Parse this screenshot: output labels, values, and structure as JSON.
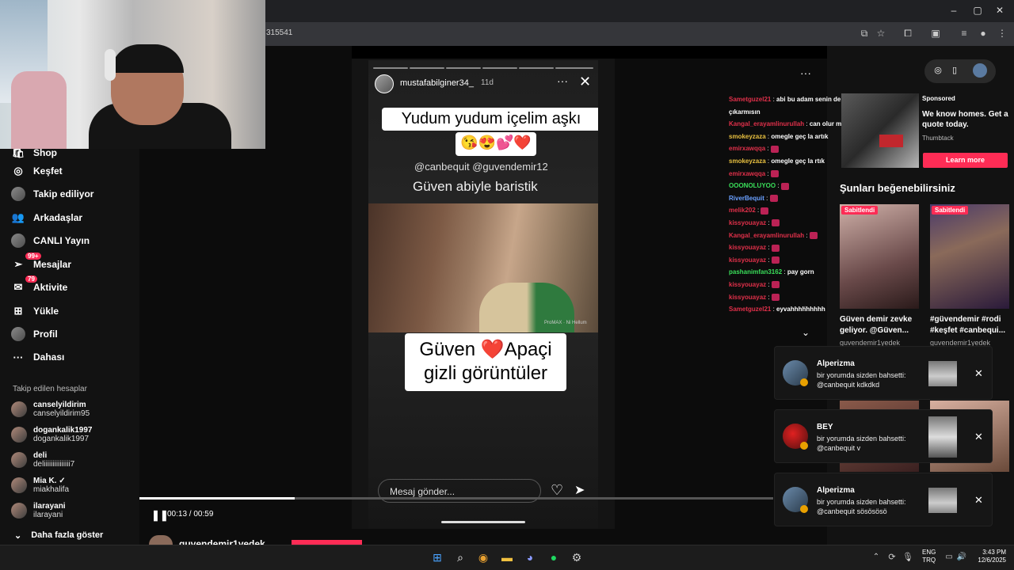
{
  "browser": {
    "url_fragment": "315541",
    "window_controls": [
      "minimize",
      "maximize",
      "close"
    ]
  },
  "sidebar": {
    "items": [
      {
        "label": "Shop",
        "icon": "shop-icon"
      },
      {
        "label": "Keşfet",
        "icon": "compass-icon"
      },
      {
        "label": "Takip ediliyor",
        "icon": "following-avatar-icon"
      },
      {
        "label": "Arkadaşlar",
        "icon": "friends-icon"
      },
      {
        "label": "CANLI Yayın",
        "icon": "live-icon"
      },
      {
        "label": "Mesajlar",
        "icon": "messages-icon",
        "badge": "99+"
      },
      {
        "label": "Aktivite",
        "icon": "activity-icon",
        "badge": "79"
      },
      {
        "label": "Yükle",
        "icon": "upload-icon"
      },
      {
        "label": "Profil",
        "icon": "profile-icon"
      },
      {
        "label": "Dahası",
        "icon": "more-icon"
      }
    ],
    "following_title": "Takip edilen hesaplar",
    "accounts": [
      {
        "name": "canselyildirim",
        "handle": "canselyildirim95"
      },
      {
        "name": "dogankalik1997",
        "handle": "dogankalik1997"
      },
      {
        "name": "deli",
        "handle": "deliiiiiiiiiiiiiii7"
      },
      {
        "name": "Mia K. ✓",
        "handle": "miakhalifa"
      },
      {
        "name": "ilarayani",
        "handle": "ilarayani"
      }
    ],
    "show_more": "Daha fazla göster"
  },
  "story": {
    "username": "mustafabilginer34_",
    "time": "11d",
    "caption1": "Yudum yudum içelim aşkı",
    "caption_emoji": "😘😍💕❤️",
    "mentions": "@canbequit @guvendemir12",
    "subline": "Güven abiyle baristik",
    "watermark": "ProMAX  · Ni Hellum",
    "caption2_line1": "Güven ❤️Apaçi",
    "caption2_line2": "gizli görüntüler",
    "message_placeholder": "Mesaj gönder...",
    "progress_segments": 6
  },
  "video": {
    "time": "00:13 / 00:59",
    "progress": 0.245
  },
  "chat": [
    {
      "user": "Sametguzel21",
      "color": "#e0304a",
      "msg": "abi bu adam senin de ifşanı"
    },
    {
      "user": "",
      "color": "#ffffff",
      "msg": "çıkarmısın"
    },
    {
      "user": "Kangal_erayamlinurullah",
      "color": "#e0304a",
      "msg": "can olur musun"
    },
    {
      "user": "smokeyzaza",
      "color": "#e8c040",
      "msg": "omegle geç la artık"
    },
    {
      "user": "emirxawqqa",
      "color": "#e0304a",
      "msg": "",
      "emote": true
    },
    {
      "user": "smokeyzaza",
      "color": "#e8c040",
      "msg": "omegle geç la rtık"
    },
    {
      "user": "emirxawqqa",
      "color": "#e0304a",
      "msg": "",
      "emote": true
    },
    {
      "user": "OOONOLUYOO",
      "color": "#3adf5a",
      "msg": "",
      "emote": true
    },
    {
      "user": "RiverBequit",
      "color": "#6aa0ff",
      "msg": "",
      "emote": true
    },
    {
      "user": "melik202",
      "color": "#e0304a",
      "msg": "",
      "emote": true
    },
    {
      "user": "kissyouayaz",
      "color": "#e0304a",
      "msg": "",
      "emote": true
    },
    {
      "user": "Kangal_erayamlinurullah",
      "color": "#e0304a",
      "msg": "",
      "emote": true
    },
    {
      "user": "kissyouayaz",
      "color": "#e0304a",
      "msg": "",
      "emote": true
    },
    {
      "user": "kissyouayaz",
      "color": "#e0304a",
      "msg": "",
      "emote": true
    },
    {
      "user": "pashanimfan3162",
      "color": "#3adf5a",
      "msg": "pay gorn"
    },
    {
      "user": "kissyouayaz",
      "color": "#e0304a",
      "msg": "",
      "emote": true
    },
    {
      "user": "kissyouayaz",
      "color": "#e0304a",
      "msg": "",
      "emote": true
    },
    {
      "user": "Sametguzel21",
      "color": "#e0304a",
      "msg": "eyvahhhhhhhhh"
    }
  ],
  "ad": {
    "sponsored": "Sponsored",
    "title": "We know homes. Get a quote today.",
    "brand": "Thumbtack",
    "cta": "Learn more"
  },
  "suggestions": {
    "title": "Şunları beğenebilirsiniz",
    "items": [
      {
        "pin": "Sabitlendi",
        "text": "Güven demir zevke geliyor. @Güven...",
        "user": "guvendemir1yedek"
      },
      {
        "pin": "Sabitlendi",
        "text": "#güvendemir #rodi #keşfet #canbequi...",
        "user": "guvendemir1yedek"
      }
    ]
  },
  "notifications": [
    {
      "name": "Alperizma",
      "line1": "bir yorumda sizden bahsetti:",
      "line2": "@canbequit kdkdkd"
    },
    {
      "name": "BEY",
      "line1": "bir yorumda sizden bahsetti:",
      "line2": "@canbequit v"
    },
    {
      "name": "Alperizma",
      "line1": "bir yorumda sizden bahsetti:",
      "line2": "@canbequit sösösösö"
    }
  ],
  "bottom": {
    "username": "guvendemir1yedek"
  },
  "taskbar": {
    "lang1": "ENG",
    "lang2": "TRQ",
    "time": "3:43 PM",
    "date": "12/6/2025"
  }
}
